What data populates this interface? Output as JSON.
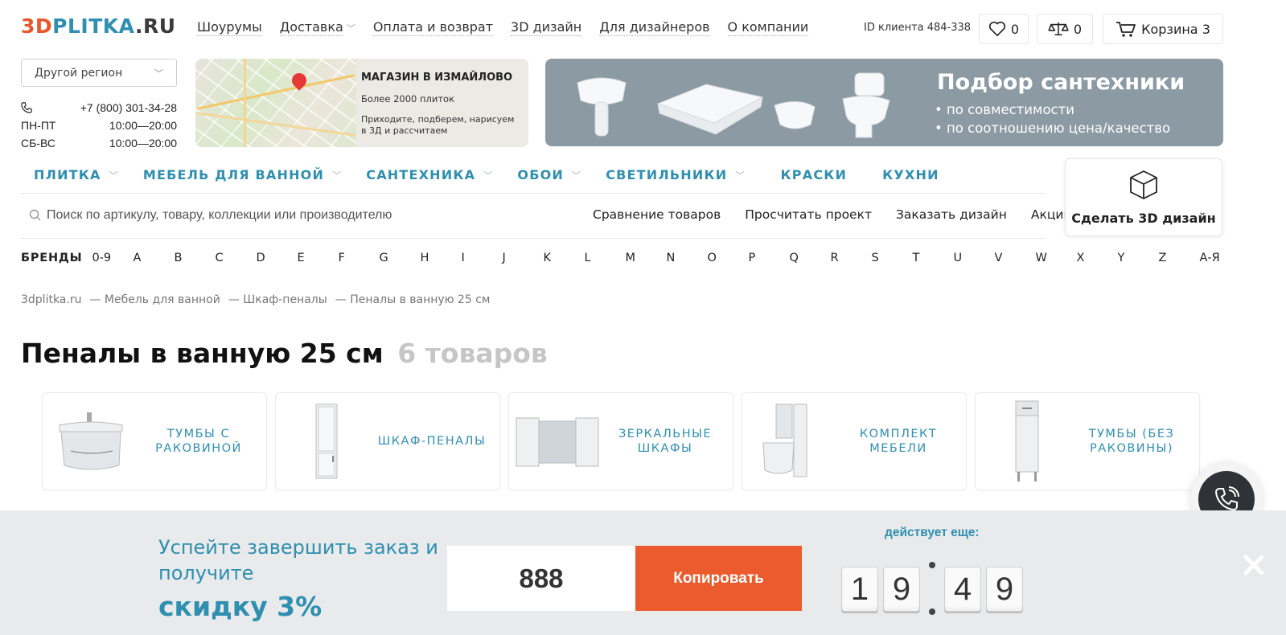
{
  "logo": {
    "part1": "3D",
    "part2": "PLITKA",
    "part3": ".RU"
  },
  "topnav": [
    {
      "label": "Шоурумы",
      "dropdown": false
    },
    {
      "label": "Доставка",
      "dropdown": true
    },
    {
      "label": "Оплата и возврат",
      "dropdown": false
    },
    {
      "label": "3D дизайн",
      "dropdown": false
    },
    {
      "label": "Для дизайнеров",
      "dropdown": false
    },
    {
      "label": "О компании",
      "dropdown": false
    }
  ],
  "client_id": "ID клиента 484-338",
  "favorites_count": "0",
  "compare_count": "0",
  "cart_label": "Корзина 3",
  "region_label": "Другой регион",
  "contacts": {
    "phone": "+7 (800) 301-34-28",
    "weekdays_label": "ПН-ПТ",
    "weekdays_hours": "10:00—20:00",
    "weekend_label": "СБ-ВС",
    "weekend_hours": "10:00—20:00"
  },
  "map_banner": {
    "title": "МАГАЗИН В ИЗМАЙЛОВО",
    "subtitle": "Более 2000 плиток",
    "text": "Приходите, подберем, нарисуем в 3Д и рассчитаем"
  },
  "sant_banner": {
    "title": "Подбор сантехники",
    "line1": "• по совместимости",
    "line2": "• по соотношению цена/качество"
  },
  "main_nav": [
    {
      "label": "ПЛИТКА",
      "dropdown": true
    },
    {
      "label": "МЕБЕЛЬ ДЛЯ ВАННОЙ",
      "dropdown": true
    },
    {
      "label": "САНТЕХНИКА",
      "dropdown": true
    },
    {
      "label": "ОБОИ",
      "dropdown": true
    },
    {
      "label": "СВЕТИЛЬНИКИ",
      "dropdown": true
    },
    {
      "label": "КРАСКИ",
      "dropdown": false
    },
    {
      "label": "КУХНИ",
      "dropdown": false
    }
  ],
  "search": {
    "placeholder": "Поиск по артикулу, товару, коллекции или производителю"
  },
  "sublinks": [
    "Сравнение товаров",
    "Просчитать проект",
    "Заказать дизайн",
    "Акции"
  ],
  "make3d_label": "Сделать 3D дизайн",
  "brands": {
    "label": "БРЕНДЫ",
    "letters": [
      "0-9",
      "A",
      "B",
      "C",
      "D",
      "E",
      "F",
      "G",
      "H",
      "I",
      "J",
      "K",
      "L",
      "M",
      "N",
      "O",
      "P",
      "Q",
      "R",
      "S",
      "T",
      "U",
      "V",
      "W",
      "X",
      "Y",
      "Z",
      "А-Я"
    ]
  },
  "breadcrumbs": [
    "3dplitka.ru",
    "— Мебель для ванной",
    "— Шкаф-пеналы",
    "— Пеналы в ванную 25 см"
  ],
  "page_title": "Пеналы в ванную 25 см",
  "product_count": "6 товаров",
  "categories": [
    {
      "label": "ТУМБЫ С РАКОВИНОЙ",
      "icon": "vanity-with-sink"
    },
    {
      "label": "ШКАФ-ПЕНАЛЫ",
      "icon": "tall-cabinet"
    },
    {
      "label": "ЗЕРКАЛЬНЫЕ ШКАФЫ",
      "icon": "mirror-cabinet"
    },
    {
      "label": "КОМПЛЕКТ МЕБЕЛИ",
      "icon": "furniture-set"
    },
    {
      "label": "ТУМБЫ (БЕЗ РАКОВИНЫ)",
      "icon": "cabinet-no-sink"
    }
  ],
  "promo": {
    "text": "Успейте завершить заказ и получите",
    "discount": "скидку 3%",
    "code": "888",
    "copy_label": "Копировать",
    "valid_label": "действует еще:",
    "timer_digits": [
      "1",
      "9",
      "4",
      "9"
    ]
  },
  "colors": {
    "accent_blue": "#2f8fb0",
    "accent_orange": "#eb5b2d",
    "promo_bg": "#e9eaeb"
  }
}
